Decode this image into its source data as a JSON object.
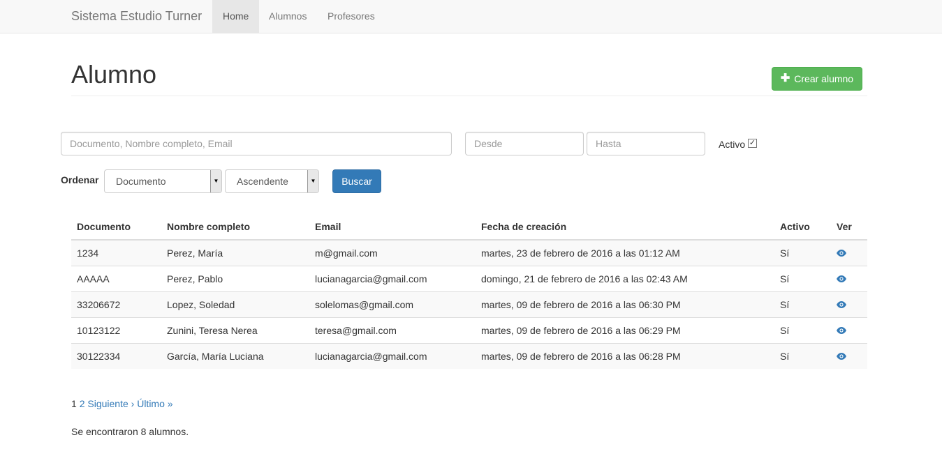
{
  "navbar": {
    "brand": "Sistema Estudio Turner",
    "items": [
      {
        "label": "Home",
        "active": true
      },
      {
        "label": "Alumnos",
        "active": false
      },
      {
        "label": "Profesores",
        "active": false
      }
    ]
  },
  "page": {
    "title": "Alumno",
    "create_button": "Crear alumno"
  },
  "filters": {
    "search_placeholder": "Documento, Nombre completo, Email",
    "desde_placeholder": "Desde",
    "hasta_placeholder": "Hasta",
    "activo_label": "Activo",
    "activo_checked": true,
    "ordenar_label": "Ordenar",
    "order_field": "Documento",
    "order_direction": "Ascendente",
    "search_button": "Buscar"
  },
  "table": {
    "headers": [
      "Documento",
      "Nombre completo",
      "Email",
      "Fecha de creación",
      "Activo",
      "Ver"
    ],
    "rows": [
      {
        "documento": "1234",
        "nombre": "Perez, María",
        "email": "m@gmail.com",
        "fecha": "martes, 23 de febrero de 2016 a las 01:12 AM",
        "activo": "Sí"
      },
      {
        "documento": "AAAAA",
        "nombre": "Perez, Pablo",
        "email": "lucianagarcia@gmail.com",
        "fecha": "domingo, 21 de febrero de 2016 a las 02:43 AM",
        "activo": "Sí"
      },
      {
        "documento": "33206672",
        "nombre": "Lopez, Soledad",
        "email": "solelomas@gmail.com",
        "fecha": "martes, 09 de febrero de 2016 a las 06:30 PM",
        "activo": "Sí"
      },
      {
        "documento": "10123122",
        "nombre": "Zunini, Teresa Nerea",
        "email": "teresa@gmail.com",
        "fecha": "martes, 09 de febrero de 2016 a las 06:29 PM",
        "activo": "Sí"
      },
      {
        "documento": "30122334",
        "nombre": "García, María Luciana",
        "email": "lucianagarcia@gmail.com",
        "fecha": "martes, 09 de febrero de 2016 a las 06:28 PM",
        "activo": "Sí"
      }
    ]
  },
  "pagination": {
    "current": "1",
    "next_page": "2",
    "next": "Siguiente ›",
    "last": "Último »"
  },
  "footer": {
    "result_text": "Se encontraron 8 alumnos."
  }
}
